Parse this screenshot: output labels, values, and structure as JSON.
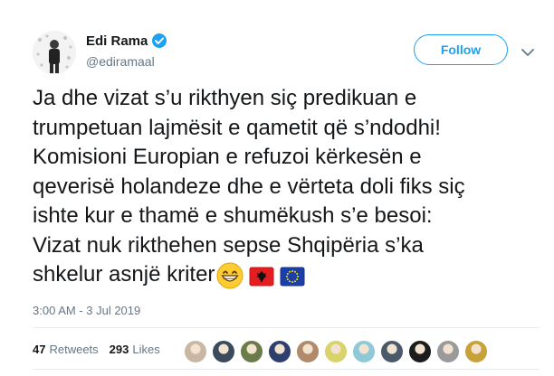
{
  "user": {
    "display_name": "Edi Rama",
    "handle": "@ediramaal",
    "follow_label": "Follow"
  },
  "tweet": {
    "lines": [
      "Ja dhe vizat s’u rikthyen siç predikuan e",
      "trumpetuan lajmësit e qametit që s’ndodhi!",
      "Komisioni Europian e refuzoi kërkesën e",
      "qeverisë holandeze dhe e vërteta doli fiks siç",
      "ishte kur e thamë e shumëkush s’e besoi:",
      "Vizat nuk rikthehen sepse Shqipëria s’ka",
      "shkelur asnjë kriter"
    ],
    "emojis": [
      "grinning-face-icon",
      "albania-flag-icon",
      "eu-flag-icon"
    ]
  },
  "timestamp": "3:00 AM - 3 Jul 2019",
  "stats": {
    "retweets": "47",
    "retweets_label": "Retweets",
    "likes": "293",
    "likes_label": "Likes"
  },
  "likers": [
    {
      "color": "#c9b7a3"
    },
    {
      "color": "#3b4a5c"
    },
    {
      "color": "#6b7c4a"
    },
    {
      "color": "#2e3f6e"
    },
    {
      "color": "#b08a6a"
    },
    {
      "color": "#d8d36a"
    },
    {
      "color": "#8ec9d8"
    },
    {
      "color": "#4a5a6a"
    },
    {
      "color": "#1c1c1c"
    },
    {
      "color": "#9a9a9a"
    },
    {
      "color": "#c7a23a"
    }
  ],
  "colors": {
    "accent": "#1da1f2",
    "muted": "#657786",
    "text": "#14171a",
    "divider": "#e6ecf0"
  }
}
